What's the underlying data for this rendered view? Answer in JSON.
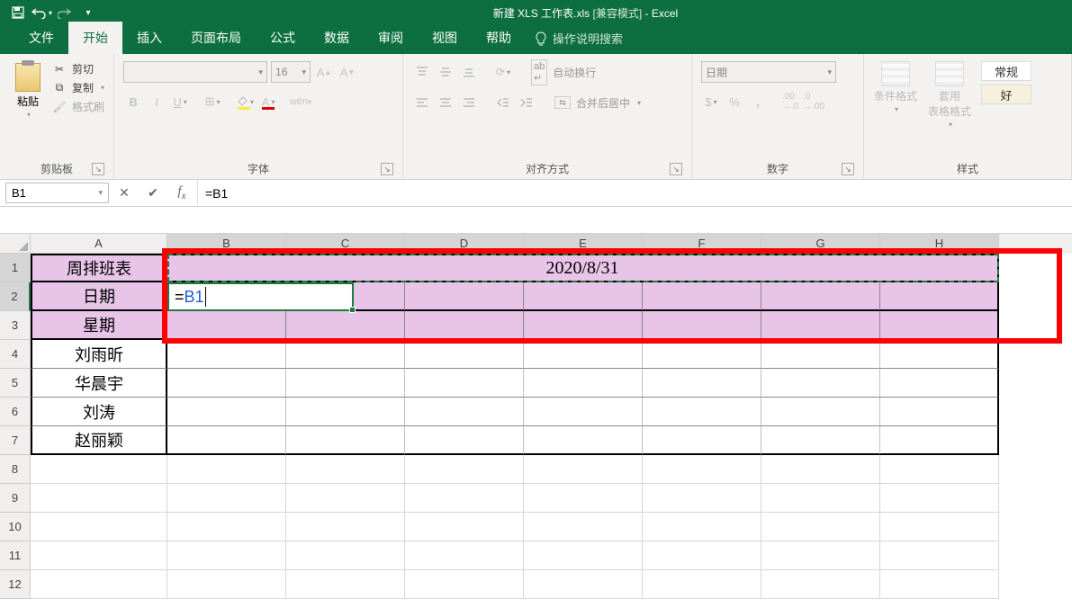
{
  "title": {
    "filename": "新建 XLS 工作表.xls",
    "mode": "[兼容模式]",
    "app": "Excel"
  },
  "qat": {
    "save": "保存",
    "undo": "撤消",
    "redo": "恢复"
  },
  "tabs": {
    "file": "文件",
    "home": "开始",
    "insert": "插入",
    "pagelayout": "页面布局",
    "formulas": "公式",
    "data": "数据",
    "review": "审阅",
    "view": "视图",
    "help": "帮助",
    "tellme": "操作说明搜索"
  },
  "ribbon": {
    "clipboard": {
      "label": "剪贴板",
      "paste": "粘贴",
      "cut": "剪切",
      "copy": "复制",
      "painter": "格式刷"
    },
    "font": {
      "label": "字体",
      "size": "16"
    },
    "align": {
      "label": "对齐方式",
      "wrap": "自动换行",
      "merge": "合并后居中"
    },
    "number": {
      "label": "数字",
      "format": "日期"
    },
    "styles": {
      "label": "样式",
      "cond": "条件格式",
      "table": "套用\n表格格式",
      "normal": "常规",
      "good": "好"
    }
  },
  "namebox": "B1",
  "formula": "=B1",
  "cols": [
    "A",
    "B",
    "C",
    "D",
    "E",
    "F",
    "G",
    "H"
  ],
  "sheetdata": {
    "A1": "周排班表",
    "B1_merged": "2020/8/31",
    "A2": "日期",
    "B2_edit_eq": "=",
    "B2_edit_ref": "B1",
    "A3": "星期",
    "A4": "刘雨昕",
    "A5": "华晨宇",
    "A6": "刘涛",
    "A7": "赵丽颖"
  },
  "rownums": [
    "1",
    "2",
    "3",
    "4",
    "5",
    "6",
    "7",
    "8",
    "9",
    "10",
    "11",
    "12"
  ]
}
